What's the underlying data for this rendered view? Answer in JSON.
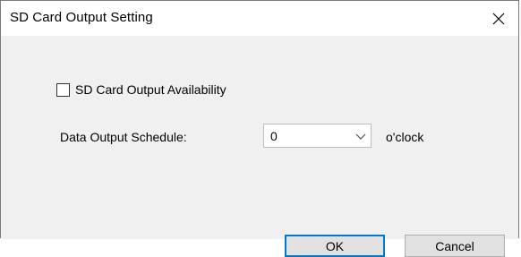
{
  "window": {
    "title": "SD Card Output Setting"
  },
  "form": {
    "availability_label": "SD Card Output Availability",
    "availability_checked": false,
    "schedule_label": "Data Output Schedule:",
    "schedule_value": "0",
    "schedule_unit": "o'clock"
  },
  "buttons": {
    "ok_label": "OK",
    "cancel_label": "Cancel"
  },
  "colors": {
    "accent": "#0078d7",
    "dialog_bg": "#f0f0f0",
    "button_bg": "#e1e1e1"
  }
}
